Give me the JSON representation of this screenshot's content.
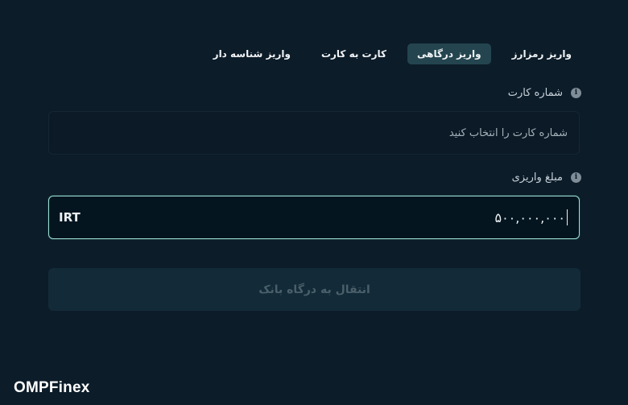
{
  "tabs": [
    {
      "label": "واریز رمزارز",
      "active": false
    },
    {
      "label": "واریز درگاهی",
      "active": true
    },
    {
      "label": "کارت به کارت",
      "active": false
    },
    {
      "label": "واریز شناسه دار",
      "active": false
    }
  ],
  "card_field": {
    "label": "شماره کارت",
    "placeholder": "شماره کارت را انتخاب کنید",
    "info_icon": "info-icon"
  },
  "amount_field": {
    "label": "مبلغ واریزی",
    "value": "۵۰۰,۰۰۰,۰۰۰",
    "currency": "IRT",
    "info_icon": "info-icon"
  },
  "submit_button": {
    "label": "انتقال به درگاه بانک",
    "enabled": false
  },
  "brand": {
    "name": "OMPFinex"
  },
  "colors": {
    "background": "#0c1c29",
    "active_tab": "#24454f",
    "focus_border": "#9ee0d4",
    "disabled_button": "#132b38"
  }
}
